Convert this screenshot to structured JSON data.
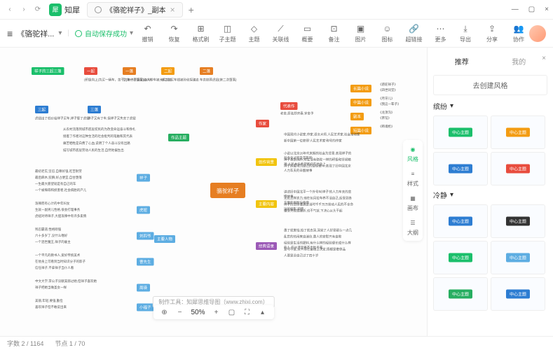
{
  "app": {
    "name": "知犀",
    "logo": "犀"
  },
  "tab": {
    "title": "《骆驼祥子》_副本"
  },
  "doc": {
    "title": "《骆驼祥...",
    "save": "自动保存成功"
  },
  "tools": [
    {
      "icon": "↶",
      "label": "撤销"
    },
    {
      "icon": "↷",
      "label": "恢复"
    },
    {
      "icon": "⊞",
      "label": "格式刷"
    },
    {
      "icon": "◫",
      "label": "子主题"
    },
    {
      "icon": "◇",
      "label": "主题"
    },
    {
      "icon": "⟋",
      "label": "关联线"
    },
    {
      "icon": "▭",
      "label": "概要"
    },
    {
      "icon": "⊡",
      "label": "备注"
    },
    {
      "icon": "▣",
      "label": "图片"
    },
    {
      "icon": "☺",
      "label": "图标"
    },
    {
      "icon": "🔗",
      "label": "超链接"
    },
    {
      "icon": "⋯",
      "label": "更多"
    }
  ],
  "rtools": [
    {
      "icon": "⤓",
      "label": "导出"
    },
    {
      "icon": "⇪",
      "label": "分享"
    },
    {
      "icon": "👥",
      "label": "协作"
    }
  ],
  "center": "骆驼祥子",
  "top": {
    "header": "祥子的三起三落",
    "items": [
      "一起",
      "一落",
      "二起",
      "二落"
    ],
    "sub": [
      "(积极向上)为买一辆车，苦干三年终于凑足100块",
      "军(第一次堕落)连人带车被大兵抓走",
      "第二次买车钱被孙侦探骗走",
      "车卖掉葬虎妞(第二次堕落)"
    ],
    "b1": "三起",
    "b2": "三落",
    "bsub": [
      "虎妞出了低价给祥子买车,祥子娶了虎妞",
      "祥子又有了车,但祥子又失去了虎妞"
    ]
  },
  "left": {
    "theme": "作品主题",
    "theme_txt": [
      "从农村流落到城市底层贫民的为改变命运奋斗和挣扎",
      "接着了作者对这种生活的社会批判的笔触和其代表",
      "痛苦牺牲是白费了心血,说明了个人奋斗没有出路",
      "描写城市底层劳动人民的生活,自然地偏生出"
    ],
    "main": "主要人物",
    "ppl": [
      {
        "n": "祥子",
        "t": [
          "最初老实,坚忍,自尊好强,吃苦耐劳",
          "最后麻木,狡猾,好占便宜,自甘堕落",
          "一生最大愿望就是有自己的车",
          "一个被侮辱和损害者,社会病胎的产儿"
        ]
      },
      {
        "n": "虎妞",
        "t": [
          "泼辣而有心计的中年妇女",
          "生就一副男儿性格,很会打理事务",
          "虎妞对待祥子,大胆泼辣中有许多柔情"
        ]
      },
      {
        "n": "刘四爷",
        "t": [
          "残忍霸道,性格刚强",
          "六十多岁了,没什么嗜好",
          "一个混世魔王,祥子的雇主"
        ]
      },
      {
        "n": "曹先生",
        "t": [
          "一个平凡的教书人,爱好传统美术",
          "在他身上可看到当时知识分子的影子",
          "信任祥子,不拿祥子当仆人看"
        ]
      },
      {
        "n": "周瑛",
        "t": [
          "中文大学,李公子没献美丽过她,但祥子喜欢她",
          "祥子把她当做圣女一样"
        ]
      },
      {
        "n": "小福子",
        "t": [
          "美丽,年轻,要强,勤俭",
          "喜欢祥子但不敢说出来"
        ]
      }
    ]
  },
  "right": {
    "author": "作家",
    "author_t": "老舍,原名舒庆春,字舍予",
    "works": "代表作",
    "wlist": [
      {
        "l": "长篇小说",
        "w": [
          "《骆驼祥子》",
          "《四世同堂》"
        ]
      },
      {
        "l": "中篇小说",
        "w": [
          "《月牙儿》",
          "《我这一辈子》"
        ]
      },
      {
        "l": "剧本",
        "w": [
          "《龙须沟》",
          "《茶馆》"
        ]
      },
      {
        "l": "短篇小说",
        "w": [
          "《断魂枪》"
        ]
      }
    ],
    "status": [
      "中国现代小说家,作家,语言大师,人民艺术家,社会活动家",
      "新中国第一位获得'人民艺术家'称号的作家"
    ],
    "bg": "创作背景",
    "bg_t": [
      "小说以北京20年代末期的社会为背景,表现祥子的社会化过程及其影响",
      "祥子善良纯朴,对生活有骆驼一样的积极和坚韧精神,人民本份希望寄托在他身上",
      "祥子执着地为自己的目标奋斗,表现了旧中国北京人力车夫的辛酸故事"
    ],
    "content": "主要内容",
    "content_t": [
      "讲述旧中国北平一个外号叫'祥子'的人力车夫的悲惨故事",
      "无论怎样卖力,他在包月拉车养不活自己,反受到各方面的剥削与侮辱",
      "祥子的悲惨遭遇是当时千千万万劳动人民的不幸命运的缩影,即使",
      "遭受失败或挫折,也不气馁,下决心从头干起"
    ],
    "quote": "经典语录",
    "quote_t": [
      "愚了就害怕,怕了就去哭,哭完了人好受那么一点几",
      "乱世的热闹来自迷信,愚人的安慰只有自欺",
      "经验是生活的肥料,有什么样的经验便长成什么样的人,在沙漠里养不出牡丹来",
      "爱与不爱,穷人得在金钱上决定,情都是奢侈品",
      "人要是没自己过了四十岁"
    ]
  },
  "credit": "制作工具：知犀思维导图（www.zhixi.com）",
  "side": {
    "tabs": [
      "推荐",
      "我的"
    ],
    "create": "去创建风格",
    "s1": "缤纷",
    "s2": "冷静",
    "thumb": "中心主题"
  },
  "float": [
    {
      "i": "◉",
      "l": "风格"
    },
    {
      "i": "≡",
      "l": "样式"
    },
    {
      "i": "▦",
      "l": "画布"
    },
    {
      "i": "☰",
      "l": "大纲"
    }
  ],
  "zoom": {
    "out": "−",
    "pct": "50%",
    "in": "+"
  },
  "status": {
    "words": "字数 2 / 1164",
    "nodes": "节点 1 / 70"
  }
}
